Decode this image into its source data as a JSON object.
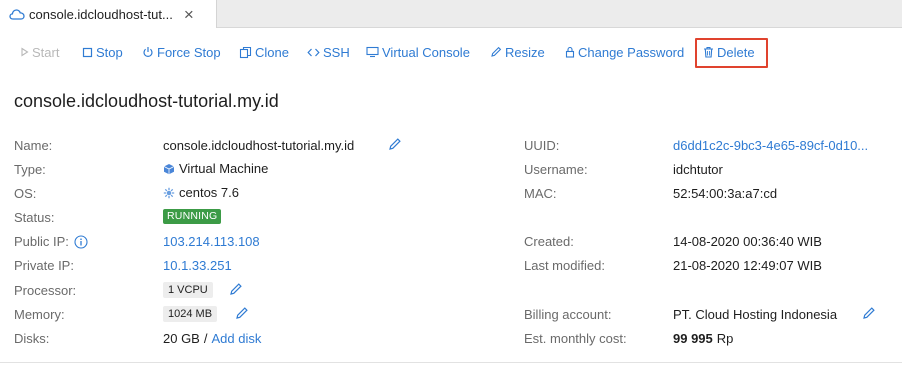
{
  "tab": {
    "title": "console.idcloudhost-tut...",
    "close": "×"
  },
  "toolbar": {
    "start": "Start",
    "stop": "Stop",
    "force_stop": "Force Stop",
    "clone": "Clone",
    "ssh": "SSH",
    "virtual_console": "Virtual Console",
    "resize": "Resize",
    "change_password": "Change Password",
    "delete": "Delete"
  },
  "heading": "console.idcloudhost-tutorial.my.id",
  "details": {
    "name_label": "Name:",
    "name_value": "console.idcloudhost-tutorial.my.id",
    "type_label": "Type:",
    "type_value": "Virtual Machine",
    "os_label": "OS:",
    "os_value": "centos 7.6",
    "status_label": "Status:",
    "status_value": "RUNNING",
    "public_ip_label": "Public IP:",
    "public_ip_value": "103.214.113.108",
    "private_ip_label": "Private IP:",
    "private_ip_value": "10.1.33.251",
    "processor_label": "Processor:",
    "processor_value": "1 VCPU",
    "memory_label": "Memory:",
    "memory_value": "1024 MB",
    "disks_label": "Disks:",
    "disks_value": "20 GB",
    "disks_sep": "/",
    "add_disk": "Add disk",
    "uuid_label": "UUID:",
    "uuid_value": "d6dd1c2c-9bc3-4e65-89cf-0d10...",
    "username_label": "Username:",
    "username_value": "idchtutor",
    "mac_label": "MAC:",
    "mac_value": "52:54:00:3a:a7:cd",
    "created_label": "Created:",
    "created_value": "14-08-2020 00:36:40 WIB",
    "modified_label": "Last modified:",
    "modified_value": "21-08-2020 12:49:07 WIB",
    "billing_label": "Billing account:",
    "billing_value": "PT. Cloud Hosting Indonesia",
    "cost_label": "Est. monthly cost:",
    "cost_amount": "99 995",
    "cost_currency": "Rp"
  },
  "colors": {
    "link": "#2f7bd3",
    "running": "#3c9b46",
    "highlight": "#e0432e"
  }
}
